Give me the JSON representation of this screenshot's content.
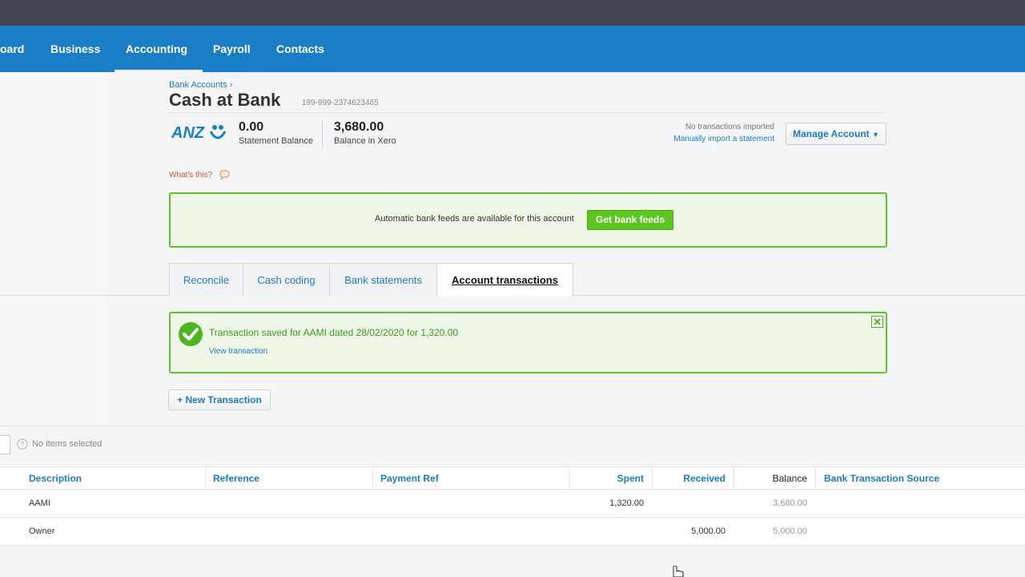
{
  "nav": {
    "items": [
      {
        "label": "oard"
      },
      {
        "label": "Business"
      },
      {
        "label": "Accounting"
      },
      {
        "label": "Payroll"
      },
      {
        "label": "Contacts"
      }
    ],
    "active": "Accounting"
  },
  "header": {
    "breadcrumb": "Bank Accounts ›",
    "title": "Cash at Bank",
    "account_number": "199-999-2374623465",
    "bank_logo_text": "ANZ",
    "statement_balance": "0.00",
    "statement_balance_label": "Statement Balance",
    "xero_balance": "3,680.00",
    "xero_balance_label": "Balance in Xero",
    "no_transactions": "No transactions imported",
    "manual_import": "Manually import a statement",
    "manage_account": "Manage Account"
  },
  "whats_this": "What's this?",
  "feed": {
    "text": "Automatic bank feeds are available for this account",
    "button": "Get bank feeds"
  },
  "tabs": [
    {
      "label": "Reconcile"
    },
    {
      "label": "Cash coding"
    },
    {
      "label": "Bank statements"
    },
    {
      "label": "Account transactions"
    }
  ],
  "message": {
    "text": "Transaction saved for AAMI dated 28/02/2020 for 1,320.00",
    "link": "View transaction"
  },
  "new_transaction": "+ New Transaction",
  "selection": "No items selected",
  "table": {
    "columns": [
      "Description",
      "Reference",
      "Payment Ref",
      "Spent",
      "Received",
      "Balance",
      "Bank Transaction Source"
    ],
    "rows": [
      {
        "description": "AAMI",
        "reference": "",
        "payment_ref": "",
        "spent": "1,320.00",
        "received": "",
        "balance": "3,680.00",
        "source": ""
      },
      {
        "description": "Owner",
        "reference": "",
        "payment_ref": "",
        "spent": "",
        "received": "5,000.00",
        "balance": "5,000.00",
        "source": ""
      }
    ]
  },
  "colors": {
    "nav_bg": "#1a7ec6",
    "top_bar": "#404551",
    "success_green": "#5fc12f",
    "link_blue": "#1f7cc1"
  },
  "icons": [
    "anz-logo-icon",
    "speech-bubble-icon",
    "check-circle-icon",
    "close-icon",
    "help-icon",
    "cursor-hand-icon",
    "caret-down-icon"
  ]
}
